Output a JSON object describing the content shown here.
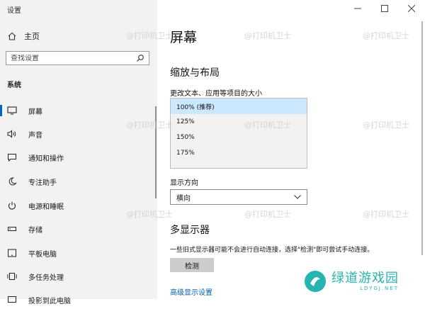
{
  "window": {
    "title": "设置"
  },
  "nav": {
    "home_label": "主页",
    "search_placeholder": "查找设置",
    "section_label": "系统",
    "items": [
      {
        "label": "屏幕",
        "icon": "monitor-icon",
        "active": true
      },
      {
        "label": "声音",
        "icon": "speaker-icon"
      },
      {
        "label": "通知和操作",
        "icon": "notification-icon"
      },
      {
        "label": "专注助手",
        "icon": "moon-icon"
      },
      {
        "label": "电源和睡眠",
        "icon": "power-icon"
      },
      {
        "label": "存储",
        "icon": "storage-icon"
      },
      {
        "label": "平板电脑",
        "icon": "tablet-icon"
      },
      {
        "label": "多任务处理",
        "icon": "multitask-icon"
      },
      {
        "label": "投影到此电脑",
        "icon": "project-icon"
      }
    ]
  },
  "content": {
    "page_title": "屏幕",
    "scale_section_title": "缩放与布局",
    "scale_label": "更改文本、应用等项目的大小",
    "scale_options": [
      "100% (推荐)",
      "125%",
      "150%",
      "175%"
    ],
    "orientation_label": "显示方向",
    "orientation_value": "横向",
    "multi_display_title": "多显示器",
    "multi_display_desc": "一些旧式显示器可能不会进行自动连接，选择\"检测\"即可尝试手动连接。",
    "detect_button": "检测",
    "advanced_link": "高级显示设置"
  },
  "watermark": {
    "text": "@打印机卫士"
  },
  "logo": {
    "text": "绿道游戏园",
    "sub": "LDYGJ.NET"
  },
  "colors": {
    "accent": "#0067c0",
    "selected_option": "#cce8ff",
    "nav_bg": "#f2f2f2",
    "link": "#0063b1",
    "logo": "#27b3b0"
  }
}
